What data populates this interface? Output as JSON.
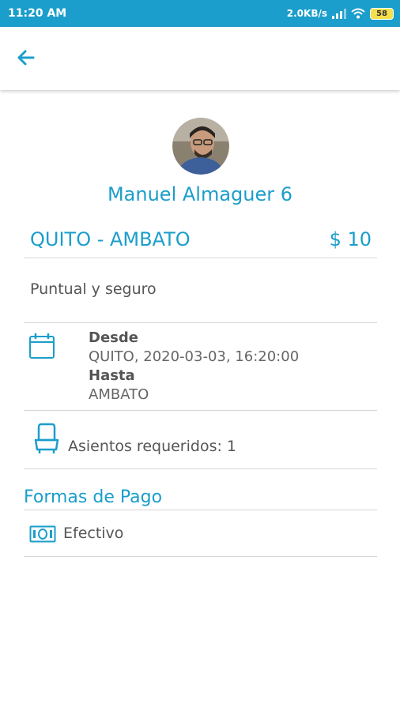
{
  "status_bar": {
    "time": "11:20 AM",
    "network_speed": "2.0KB/s",
    "battery": "58"
  },
  "app_bar": {
    "back_icon": "arrow-left-icon"
  },
  "driver": {
    "name": "Manuel Almaguer 6",
    "avatar_icon": "avatar-photo"
  },
  "trip": {
    "route": "QUITO - AMBATO",
    "price": "$ 10",
    "description": "Puntual y seguro",
    "from_label": "Desde",
    "from_value": "QUITO, 2020-03-03, 16:20:00",
    "to_label": "Hasta",
    "to_value": "AMBATO",
    "seats": "Asientos requeridos: 1"
  },
  "payment": {
    "heading": "Formas de Pago",
    "method": "Efectivo"
  },
  "colors": {
    "accent": "#1b9ecb",
    "text": "#555555",
    "divider": "#d6d6d6"
  }
}
